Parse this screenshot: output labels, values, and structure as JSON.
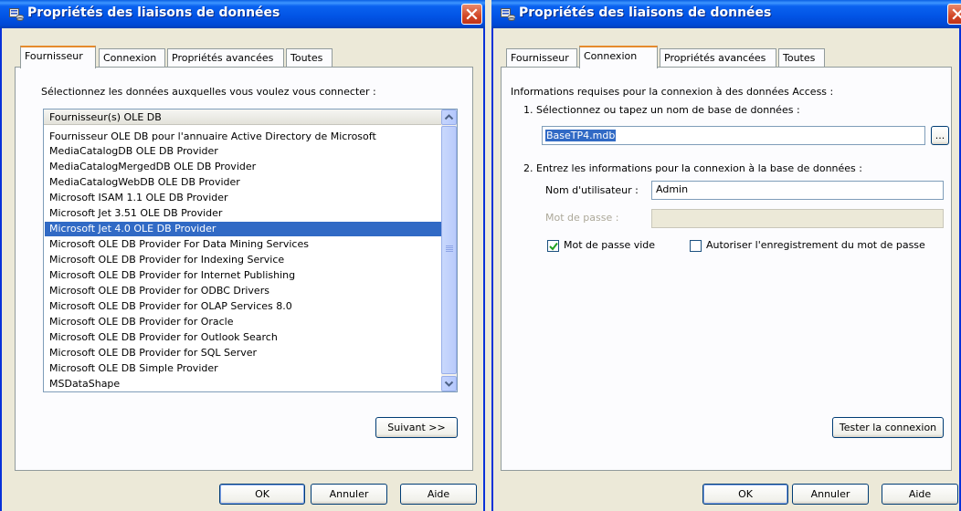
{
  "colors": {
    "title_blue": "#0255e6",
    "selection": "#316ac5",
    "dialog_bg": "#ece9d8",
    "close_red": "#d24726"
  },
  "icons": {
    "title": "data-link-icon",
    "close": "close-icon",
    "scroll_up": "arrow-up-icon",
    "scroll_down": "arrow-down-icon",
    "checkmark": "checkmark-icon"
  },
  "left_dialog": {
    "title": "Propriétés des liaisons de données",
    "tabs": [
      "Fournisseur",
      "Connexion",
      "Propriétés avancées",
      "Toutes"
    ],
    "active_tab": "Fournisseur",
    "instruction": "Sélectionnez les données auxquelles vous voulez vous connecter :",
    "list_header": "Fournisseur(s) OLE DB",
    "providers": [
      "Fournisseur OLE DB pour l'annuaire Active Directory de Microsoft",
      "MediaCatalogDB OLE DB Provider",
      "MediaCatalogMergedDB OLE DB Provider",
      "MediaCatalogWebDB OLE DB Provider",
      "Microsoft ISAM 1.1 OLE DB Provider",
      "Microsoft Jet 3.51 OLE DB Provider",
      "Microsoft Jet 4.0 OLE DB Provider",
      "Microsoft OLE DB Provider For Data Mining Services",
      "Microsoft OLE DB Provider for Indexing Service",
      "Microsoft OLE DB Provider for Internet Publishing",
      "Microsoft OLE DB Provider for ODBC Drivers",
      "Microsoft OLE DB Provider for OLAP Services 8.0",
      "Microsoft OLE DB Provider for Oracle",
      "Microsoft OLE DB Provider for Outlook Search",
      "Microsoft OLE DB Provider for SQL Server",
      "Microsoft OLE DB Simple Provider",
      "MSDataShape"
    ],
    "selected_provider": "Microsoft Jet 4.0 OLE DB Provider",
    "next_button": "Suivant >>",
    "ok_button": "OK",
    "cancel_button": "Annuler",
    "help_button": "Aide"
  },
  "right_dialog": {
    "title": "Propriétés des liaisons de données",
    "tabs": [
      "Fournisseur",
      "Connexion",
      "Propriétés avancées",
      "Toutes"
    ],
    "active_tab": "Connexion",
    "info_heading": "Informations requises pour la connexion à des données Access :",
    "step1_label": "1. Sélectionnez ou tapez un nom de base de données :",
    "database_name": "BaseTP4.mdb",
    "browse_button": "...",
    "step2_label": "2. Entrez les informations pour la connexion à la base de données :",
    "username_label": "Nom d'utilisateur :",
    "username_value": "Admin",
    "password_label": "Mot de passe :",
    "password_value": "",
    "blank_password_label": "Mot de passe vide",
    "blank_password_checked": true,
    "save_password_label": "Autoriser l'enregistrement du mot de passe",
    "save_password_checked": false,
    "test_button": "Tester la connexion",
    "ok_button": "OK",
    "cancel_button": "Annuler",
    "help_button": "Aide"
  }
}
